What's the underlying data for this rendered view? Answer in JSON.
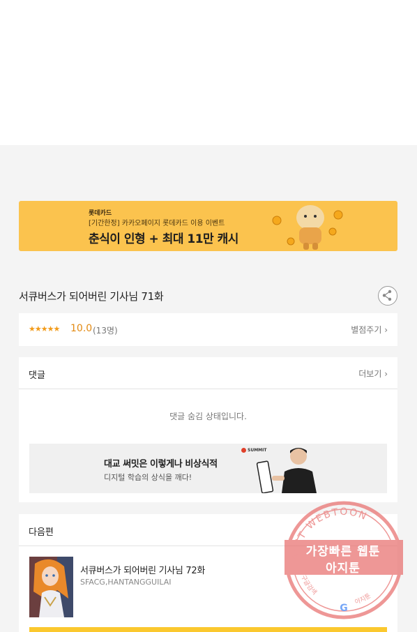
{
  "ad_banner": {
    "brand": "롯데카드",
    "sub": "[기간한정] 카카오페이지 롯데카드 이용 이벤트",
    "headline": "춘식이 인형 + 최대 11만 캐시"
  },
  "episode": {
    "title": "서큐버스가 되어버린 기사님 71화",
    "share_icon": "share-icon"
  },
  "rating": {
    "stars": "★★★★★",
    "score": "10.0",
    "count": "(13명)",
    "rate_link": "별점주기 ›"
  },
  "comments": {
    "label": "댓글",
    "more_link": "더보기 ›",
    "hidden_note": "댓글 숨김 상태입니다."
  },
  "inner_ad": {
    "title": "대교 써밋은 이렇게나 비상식적",
    "subtitle": "디지털 학습의 상식을 깨다!",
    "logo": "SUMMIT"
  },
  "next_episode": {
    "label": "다음편",
    "title": "서큐버스가 되어버린 기사님 72화",
    "author": "SFACG,HANTANGGUILAI"
  },
  "watermark": {
    "arc_text": "AGIT WEBTOON",
    "line1": "가장빠른 웹툰",
    "line2": "아지툰",
    "bottom_left": "구글검색",
    "bottom_right": "아지툰"
  },
  "colors": {
    "banner_yellow": "#fbc34e",
    "rating_orange": "#e38a12",
    "watermark_red": "#e8706f"
  }
}
